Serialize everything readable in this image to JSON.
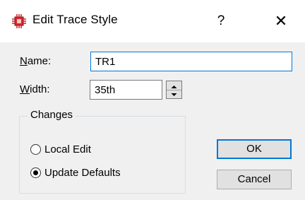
{
  "dialog": {
    "title": "Edit Trace Style",
    "help_label": "?",
    "close_label": "✕"
  },
  "form": {
    "name_label_accel": "N",
    "name_label_rest": "ame:",
    "name_value": "TR1",
    "width_label_accel": "W",
    "width_label_rest": "idth:",
    "width_value": "35th"
  },
  "changes": {
    "group_title": "Changes",
    "options": [
      {
        "label": "Local Edit",
        "selected": false
      },
      {
        "label": "Update Defaults",
        "selected": true
      }
    ]
  },
  "buttons": {
    "ok_label": "OK",
    "cancel_label": "Cancel"
  },
  "colors": {
    "accent": "#0078d7",
    "icon_red": "#d9262c"
  },
  "icons": {
    "app": "chip-icon",
    "spin_up": "triangle-up-icon",
    "spin_down": "triangle-down-icon"
  }
}
